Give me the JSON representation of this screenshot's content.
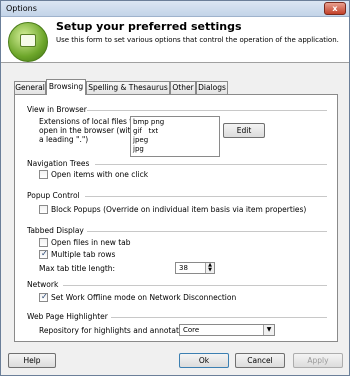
{
  "window": {
    "title": "Options",
    "close_glyph": "x"
  },
  "header": {
    "title": "Setup your preferred settings",
    "description": "Use this form to set various options that control the operation of the application."
  },
  "tabs": [
    {
      "label": "General"
    },
    {
      "label": "Browsing"
    },
    {
      "label": "Spelling & Thesaurus"
    },
    {
      "label": "Other"
    },
    {
      "label": "Dialogs"
    }
  ],
  "browser": {
    "section": "View in Browser",
    "ext_label_1": "Extensions of local files to",
    "ext_label_2": "open in the browser (without",
    "ext_label_3": "a leading \".\")",
    "ext_lines": [
      "bmp png",
      "gif   txt",
      "jpeg",
      "jpg"
    ],
    "edit": "Edit"
  },
  "nav": {
    "section": "Navigation Trees",
    "open_one_click": "Open items with one click"
  },
  "popup": {
    "section": "Popup Control",
    "block": "Block Popups (Override on individual item basis via item properties)"
  },
  "tabbed": {
    "section": "Tabbed Display",
    "new_tab": "Open files in new tab",
    "multi_rows": "Multiple tab rows",
    "max_title": "Max tab title length:",
    "max_value": "38"
  },
  "network": {
    "section": "Network",
    "offline": "Set Work Offline mode on Network Disconnection"
  },
  "highlighter": {
    "section": "Web Page Highlighter",
    "repo_label": "Repository for highlights and annotations:",
    "repo_value": "Core"
  },
  "footer": {
    "help": "Help",
    "ok": "Ok",
    "cancel": "Cancel",
    "apply": "Apply"
  }
}
